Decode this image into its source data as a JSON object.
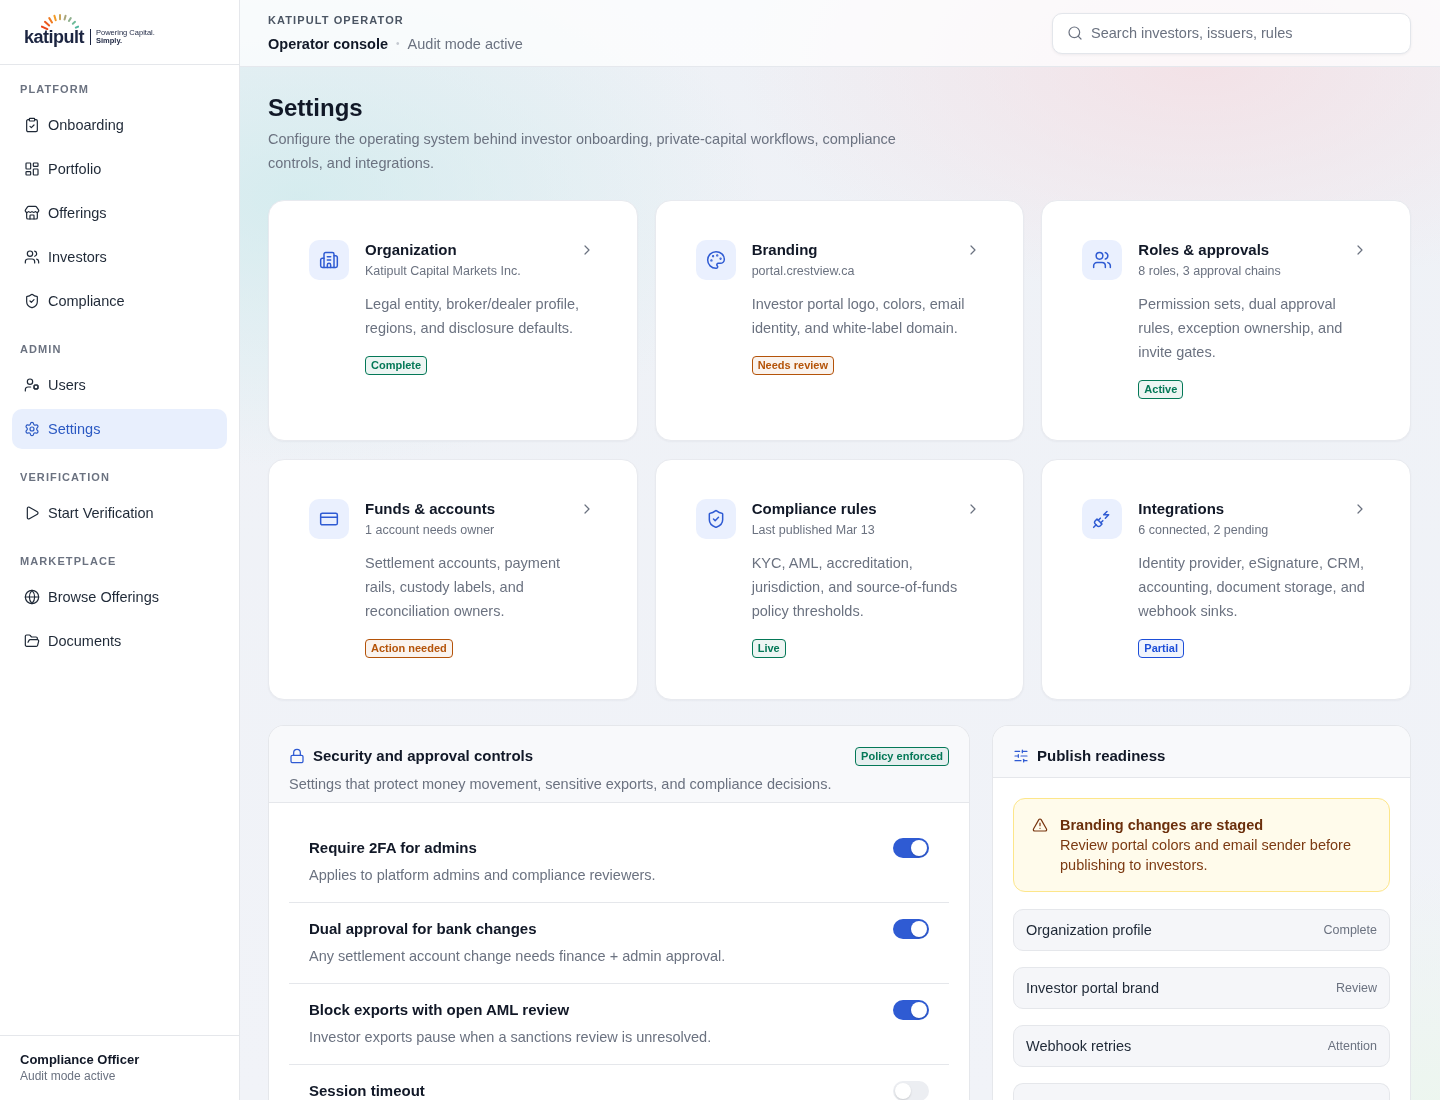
{
  "logo": {
    "wordmark": "katipult",
    "tagline": "Powering Capital. **Simply.**"
  },
  "sidebar": {
    "sections": [
      {
        "label": "PLATFORM",
        "items": [
          {
            "label": "Onboarding",
            "selected": false
          },
          {
            "label": "Portfolio",
            "selected": false
          },
          {
            "label": "Offerings",
            "selected": false
          },
          {
            "label": "Investors",
            "selected": false
          },
          {
            "label": "Compliance",
            "selected": false
          }
        ]
      },
      {
        "label": "ADMIN",
        "items": [
          {
            "label": "Users",
            "selected": false
          },
          {
            "label": "Settings",
            "selected": true
          }
        ]
      },
      {
        "label": "VERIFICATION",
        "items": [
          {
            "label": "Start Verification",
            "selected": false
          }
        ]
      },
      {
        "label": "MARKETPLACE",
        "items": [
          {
            "label": "Browse Offerings",
            "selected": false
          },
          {
            "label": "Documents",
            "selected": false
          }
        ]
      }
    ],
    "user": {
      "name": "Compliance Officer",
      "status": "Audit mode active"
    }
  },
  "header": {
    "eyebrow": "KATIPULT OPERATOR",
    "title": "Operator console",
    "separator": "•",
    "status": "Audit mode active",
    "search": {
      "placeholder": "Search investors, issuers, rules"
    }
  },
  "page": {
    "title": "Settings",
    "description": "Configure the operating system behind investor onboarding, private-capital workflows, compliance controls, and integrations."
  },
  "cards": [
    {
      "title": "Organization",
      "subtitle": "Katipult Capital Markets Inc.",
      "description": "Legal entity, broker/dealer profile, regions, and disclosure defaults.",
      "status": {
        "label": "Complete",
        "color": "#047857"
      }
    },
    {
      "title": "Branding",
      "subtitle": "portal.crestview.ca",
      "description": "Investor portal logo, colors, email identity, and white-label domain.",
      "status": {
        "label": "Needs review",
        "color": "#b45309"
      }
    },
    {
      "title": "Roles & approvals",
      "subtitle": "8 roles, 3 approval chains",
      "description": "Permission sets, dual approval rules, exception ownership, and invite gates.",
      "status": {
        "label": "Active",
        "color": "#047857"
      }
    },
    {
      "title": "Funds & accounts",
      "subtitle": "1 account needs owner",
      "description": "Settlement accounts, payment rails, custody labels, and reconciliation owners.",
      "status": {
        "label": "Action needed",
        "color": "#b45309"
      }
    },
    {
      "title": "Compliance rules",
      "subtitle": "Last published Mar 13",
      "description": "KYC, AML, accreditation, jurisdiction, and source-of-funds policy thresholds.",
      "status": {
        "label": "Live",
        "color": "#047857"
      }
    },
    {
      "title": "Integrations",
      "subtitle": "6 connected, 2 pending",
      "description": "Identity provider, eSignature, CRM, accounting, document storage, and webhook sinks.",
      "status": {
        "label": "Partial",
        "color": "#1d4ed8"
      }
    }
  ],
  "security": {
    "title": "Security and approval controls",
    "badge": {
      "label": "Policy enforced",
      "color": "#047857"
    },
    "description": "Settings that protect money movement, sensitive exports, and compliance decisions.",
    "settings": [
      {
        "title": "Require 2FA for admins",
        "description": "Applies to platform admins and compliance reviewers.",
        "on": true
      },
      {
        "title": "Dual approval for bank changes",
        "description": "Any settlement account change needs finance + admin approval.",
        "on": true
      },
      {
        "title": "Block exports with open AML review",
        "description": "Investor exports pause when a sanctions review is unresolved.",
        "on": true
      },
      {
        "title": "Session timeout",
        "on": false
      }
    ]
  },
  "readiness": {
    "title": "Publish readiness",
    "alert": {
      "title": "Branding changes are staged",
      "message": "Review portal colors and email sender before publishing to investors."
    },
    "items": [
      {
        "label": "Organization profile",
        "status": "Complete"
      },
      {
        "label": "Investor portal brand",
        "status": "Review"
      },
      {
        "label": "Webhook retries",
        "status": "Attention"
      }
    ]
  }
}
